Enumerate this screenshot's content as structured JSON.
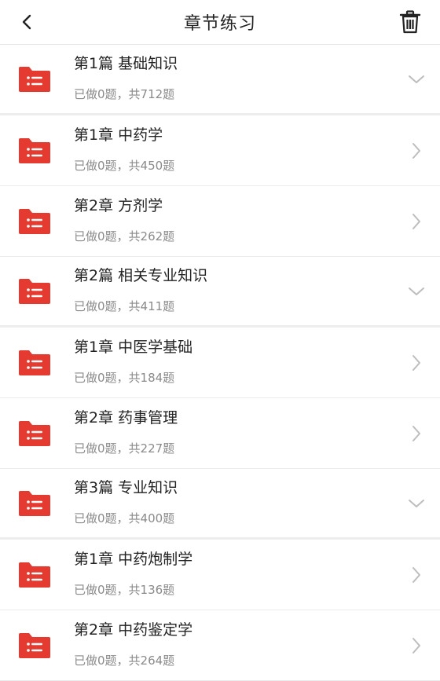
{
  "header": {
    "title": "章节练习",
    "back_icon": "chevron-left-icon",
    "trash_icon": "trash-icon"
  },
  "colors": {
    "folder_red": "#e53a2f",
    "text_primary": "#222222",
    "text_secondary": "#8a8a8a",
    "indicator": "#bdbdbd"
  },
  "items": [
    {
      "name": "第1篇 基础知识",
      "count": "已做0题，共712题",
      "kind": "section",
      "indicator": "chevron-down-icon"
    },
    {
      "name": "第1章 中药学",
      "count": "已做0题，共450题",
      "kind": "chapter",
      "indicator": "chevron-right-icon"
    },
    {
      "name": "第2章 方剂学",
      "count": "已做0题，共262题",
      "kind": "chapter",
      "indicator": "chevron-right-icon"
    },
    {
      "name": "第2篇 相关专业知识",
      "count": "已做0题，共411题",
      "kind": "section",
      "indicator": "chevron-down-icon"
    },
    {
      "name": "第1章 中医学基础",
      "count": "已做0题，共184题",
      "kind": "chapter",
      "indicator": "chevron-right-icon"
    },
    {
      "name": "第2章 药事管理",
      "count": "已做0题，共227题",
      "kind": "chapter",
      "indicator": "chevron-right-icon"
    },
    {
      "name": "第3篇 专业知识",
      "count": "已做0题，共400题",
      "kind": "section",
      "indicator": "chevron-down-icon"
    },
    {
      "name": "第1章 中药炮制学",
      "count": "已做0题，共136题",
      "kind": "chapter",
      "indicator": "chevron-right-icon"
    },
    {
      "name": "第2章 中药鉴定学",
      "count": "已做0题，共264题",
      "kind": "chapter",
      "indicator": "chevron-right-icon"
    }
  ]
}
